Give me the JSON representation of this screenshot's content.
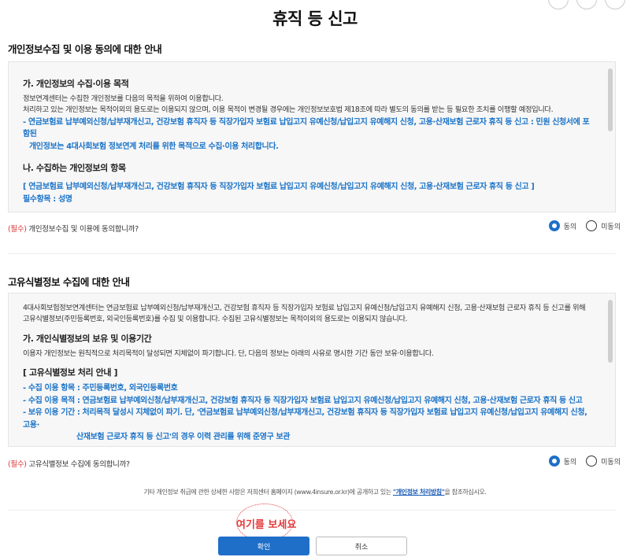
{
  "page": {
    "title": "휴직 등 신고"
  },
  "section1": {
    "title": "개인정보수집 및 이용 동의에 대한 안내",
    "a_title": "가. 개인정보의 수집·이용 목적",
    "a_line1": "정보연계센터는 수집한 개인정보를 다음의 목적을 위하여 이용합니다.",
    "a_line2": "처리하고 있는 개인정보는 목적이외의 용도로는 이용되지 않으며, 이용 목적이 변경될 경우에는 개인정보보호법 제18조에 따라 별도의 동의를 받는 등 필요한 조치를 이행할 예정입니다.",
    "a_blue1": "- 연금보험료 납부예외신청/납부재개신고, 건강보험 휴직자 등 직장가입자 보험료 납입고지 유예신청/납입고지 유예해지 신청, 고용·산재보험 근로자 휴직 등 신고 : 민원 신청서에 포함된",
    "a_blue2": "개인정보는 4대사회보험 정보연계 처리를 위한 목적으로 수집·이용 처리합니다.",
    "b_title": "나. 수집하는 개인정보의 항목",
    "b_blue1": "[ 연금보험료 납부예외신청/납부재개신고, 건강보험 휴직자 등 직장가입자 보험료 납입고지 유예신청/납입고지 유예해지 신청, 고용·산재보험 근로자 휴직 등 신고 ]",
    "b_blue2": "필수항목 : 성명",
    "question_req": "(필수)",
    "question": " 개인정보수집 및 이용에 동의합니까?",
    "agree": "동의",
    "disagree": "미동의"
  },
  "section2": {
    "title": "고유식별정보 수집에 대한 안내",
    "intro1": "4대사회보험정보연계센터는 연금보험료 납부예외신청/납부재개신고, 건강보험 휴직자 등 직장가입자 보험료 납입고지 유예신청/납입고지 유예해지 신청, 고용·산재보험 근로자 휴직 등 신고를 위해",
    "intro2": "고유식별정보(주민등록번호, 외국인등록번호)를 수집 및 이용합니다. 수집된 고유식별정보는 목적이외의 용도로는 이용되지 않습니다.",
    "a_title": "가. 개인식별정보의 보유 및 이용기간",
    "a_line1": "이용자 개인정보는 원칙적으로 처리목적이 달성되면 지체없이 파기합니다. 단, 다음의 정보는 아래의 사유로 명시한 기간 동안 보유·이용합니다.",
    "b_title": "[ 고유식별정보 처리 안내 ]",
    "item1": "- 수집 이용 항목 : 주민등록번호, 외국인등록번호",
    "item2": "- 수집 이용 목적 : 연금보험료 납부예외신청/납부재개신고, 건강보험 휴직자 등 직장가입자 보험료 납입고지 유예신청/납입고지 유예해지 신청, 고용·산재보험 근로자 휴직 등 신고",
    "item3a": "- 보유 이용 기간 : 처리목적 달성시 지체없이 파기. 단, '연금보험료 납부예외신청/납부재개신고, 건강보험 휴직자 등 직장가입자 보험료 납입고지 유예신청/납입고지 유예해지 신청, 고용·",
    "item3b": "산재보험 근로자 휴직 등 신고'의 경우 이력 관리를 위해 준영구 보관",
    "question_req": "(필수)",
    "question": " 고유식별정보 수집에 동의합니까?",
    "agree": "동의",
    "disagree": "미동의"
  },
  "notice": {
    "pre": "기타 개인정보 취급에 관한 상세한 사항은 저희센터 홈페이지 (www.4insure.or.kr)에 공개하고 있는 ",
    "link": "\"개인정보 처리방침\"",
    "post": "을 참조하십시오."
  },
  "hint": "여기를 보세요",
  "buttons": {
    "confirm": "확인",
    "cancel": "취소"
  }
}
